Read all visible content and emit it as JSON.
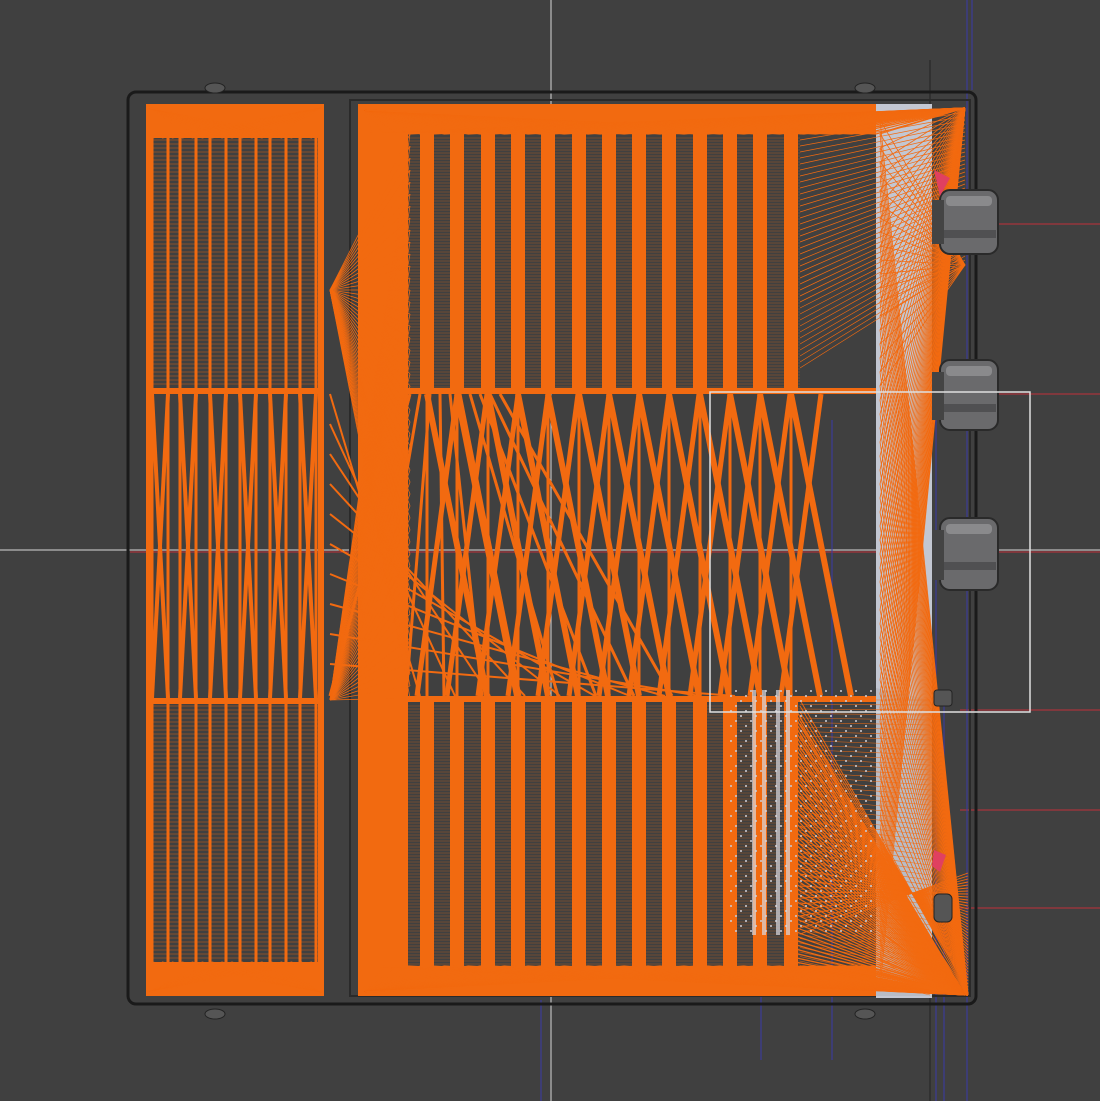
{
  "viewport": {
    "background": "#404040",
    "mesh_color": "#f26a10",
    "body_outline_color": "#1a1a1a",
    "panel_color": "#c3c7d2",
    "knob_color": "#6a6a6c",
    "guide_line_red": "#c0303a",
    "guide_line_blue": "#3a3aa8",
    "axis_line_color": "#d8d8d8",
    "selection_box_color": "#e0e0e0"
  },
  "icons": {
    "knob": "knob-icon",
    "crosshair": "crosshair-icon"
  }
}
